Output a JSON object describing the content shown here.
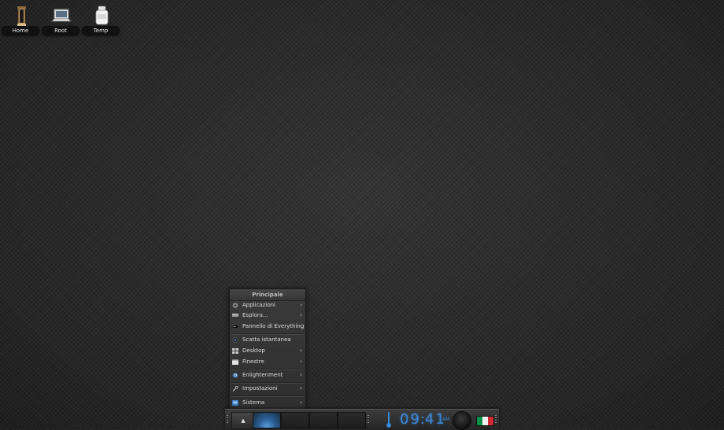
{
  "desktop": {
    "icons": [
      {
        "label": "Home",
        "icon": "trash-bin-icon"
      },
      {
        "label": "Root",
        "icon": "laptop-icon"
      },
      {
        "label": "Temp",
        "icon": "jar-icon"
      }
    ]
  },
  "menu": {
    "title": "Principale",
    "items": [
      {
        "label": "Applicazioni",
        "icon": "applications-icon",
        "submenu": true
      },
      {
        "label": "Esplora...",
        "icon": "explore-icon",
        "submenu": true
      },
      {
        "label": "Pannello di Everything",
        "icon": "everything-panel-icon",
        "submenu": false
      },
      {
        "label": "Scatta istantanea",
        "icon": "screenshot-icon",
        "submenu": false
      },
      {
        "label": "Desktop",
        "icon": "desktop-icon",
        "submenu": true
      },
      {
        "label": "Finestre",
        "icon": "windows-icon",
        "submenu": true
      },
      {
        "label": "Enlightenment",
        "icon": "enlightenment-icon",
        "submenu": true
      },
      {
        "label": "Impostazioni",
        "icon": "settings-wrench-icon",
        "submenu": true
      },
      {
        "label": "Sistema",
        "icon": "system-icon",
        "submenu": true
      }
    ],
    "arrow": "›"
  },
  "shelf": {
    "start_button_glyph": "▲",
    "pager_active_index": 0,
    "pager_count": 4,
    "clock": {
      "hours": "09",
      "separator": ":",
      "minutes": "41",
      "period": "AM"
    },
    "language_flag": "italy-flag-icon",
    "colors": {
      "accent": "#3a88d8",
      "flag_green": "#009246",
      "flag_white": "#f1f2f1",
      "flag_red": "#ce2b37"
    }
  }
}
